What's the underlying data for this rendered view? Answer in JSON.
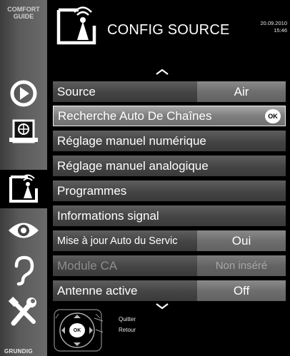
{
  "sidebar": {
    "comfort_line1": "COMFORT",
    "comfort_line2": "GUIDE",
    "items": [
      {
        "icon": "playback-icon"
      },
      {
        "icon": "globe-device-icon"
      },
      {
        "icon": "antenna-tv-icon",
        "active": true
      },
      {
        "icon": "eye-icon"
      },
      {
        "icon": "ear-icon"
      },
      {
        "icon": "tools-icon"
      }
    ],
    "brand": "GRUNDIG"
  },
  "header": {
    "title": "CONFIG SOURCE",
    "date": "20.09.2010",
    "time": "15:46"
  },
  "menu": {
    "rows": [
      {
        "label": "Source",
        "value": "Air"
      },
      {
        "label": "Recherche Auto De Chaînes",
        "badge": "OK",
        "selected": true
      },
      {
        "label": "Réglage manuel numérique"
      },
      {
        "label": "Réglage manuel analogique"
      },
      {
        "label": "Programmes"
      },
      {
        "label": "Informations signal"
      },
      {
        "label": "Mise à jour Auto du Servic",
        "value": "Oui"
      },
      {
        "label": "Module CA",
        "value": "Non inséré",
        "disabled": true
      },
      {
        "label": "Antenne active",
        "value": "Off"
      }
    ]
  },
  "legend": {
    "ok_label": "OK",
    "quit": "Quitter",
    "back": "Retour"
  },
  "colors": {
    "background": "#000000",
    "row": "#4a4a4a",
    "value_box": "#737373",
    "selected_row": "#8a8a8a"
  }
}
